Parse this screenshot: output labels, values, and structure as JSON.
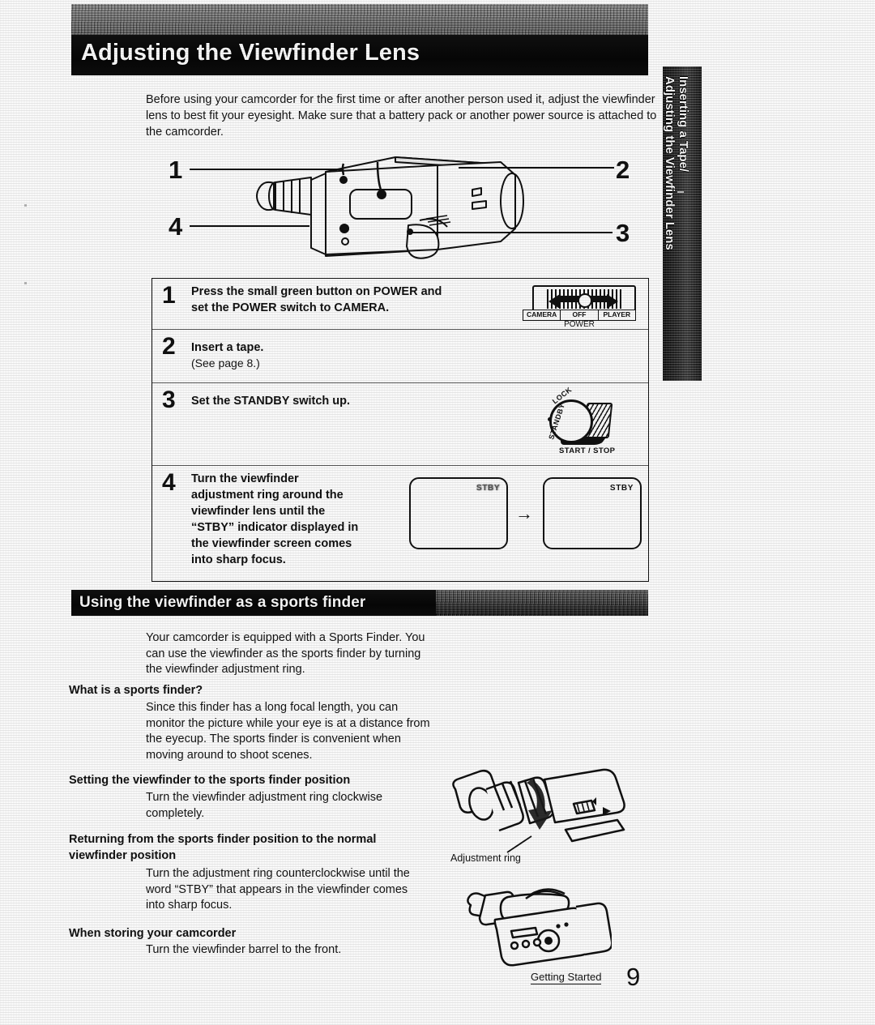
{
  "page": {
    "title": "Adjusting the Viewfinder Lens",
    "side_tab_line1": "Inserting a Tape/",
    "side_tab_line2": "Adjusting the Viewfinder Lens",
    "intro": "Before using your camcorder for the first time or after another person used it, adjust the viewfinder lens to best fit your eyesight. Make sure that a battery pack or another power source is attached to the camcorder."
  },
  "figure_callout": {
    "callouts": [
      "1",
      "2",
      "4",
      "3"
    ]
  },
  "steps": [
    {
      "number": "1",
      "text_line1": "Press the small green button on POWER and",
      "text_line2": "set the POWER switch to CAMERA.",
      "art": "power-switch"
    },
    {
      "number": "2",
      "text_line1": "Insert a tape.",
      "note": "(See page 8.)",
      "art": "none"
    },
    {
      "number": "3",
      "text_line1": "Set the STANDBY switch up.",
      "art": "standby-dial"
    },
    {
      "number": "4",
      "text_line1": "Turn the viewfinder",
      "text_line2": "adjustment ring around the",
      "text_line3": "viewfinder lens until the",
      "text_line4": "“STBY” indicator displayed in",
      "text_line5": "the viewfinder screen comes",
      "text_line6": "into sharp focus.",
      "art": "viewfinder-screens"
    }
  ],
  "power_switch": {
    "options": [
      "CAMERA",
      "OFF",
      "PLAYER"
    ],
    "caption": "POWER"
  },
  "standby_dial": {
    "lock_label": "LOCK",
    "standby_label": "STANDBY",
    "caption": "START / STOP"
  },
  "viewfinder_screens": {
    "before_label": "STBY",
    "after_label": "STBY",
    "arrow": "→"
  },
  "sports_section": {
    "heading": "Using the viewfinder as a sports finder",
    "intro": "Your camcorder is equipped with a Sports Finder. You can use the viewfinder as the sports finder by turning the viewfinder adjustment ring.",
    "subsections": [
      {
        "heading": "What is a sports finder?",
        "body": "Since this finder has a long focal length, you can monitor the picture while your eye is at a distance from the eyecup. The sports finder is convenient when moving around to shoot scenes."
      },
      {
        "heading": "Setting the viewfinder to the sports finder position",
        "body": "Turn the viewfinder adjustment ring clockwise completely."
      },
      {
        "heading": "Returning from the sports finder position to the normal viewfinder position",
        "body": "Turn the adjustment ring counterclockwise until the word “STBY” that appears in the viewfinder comes into sharp focus."
      },
      {
        "heading": "When storing your camcorder",
        "body": "Turn the viewfinder barrel to the front."
      }
    ]
  },
  "figure_ring": {
    "label": "Adjustment ring"
  },
  "footer": {
    "section": "Getting Started",
    "page_number": "9"
  }
}
